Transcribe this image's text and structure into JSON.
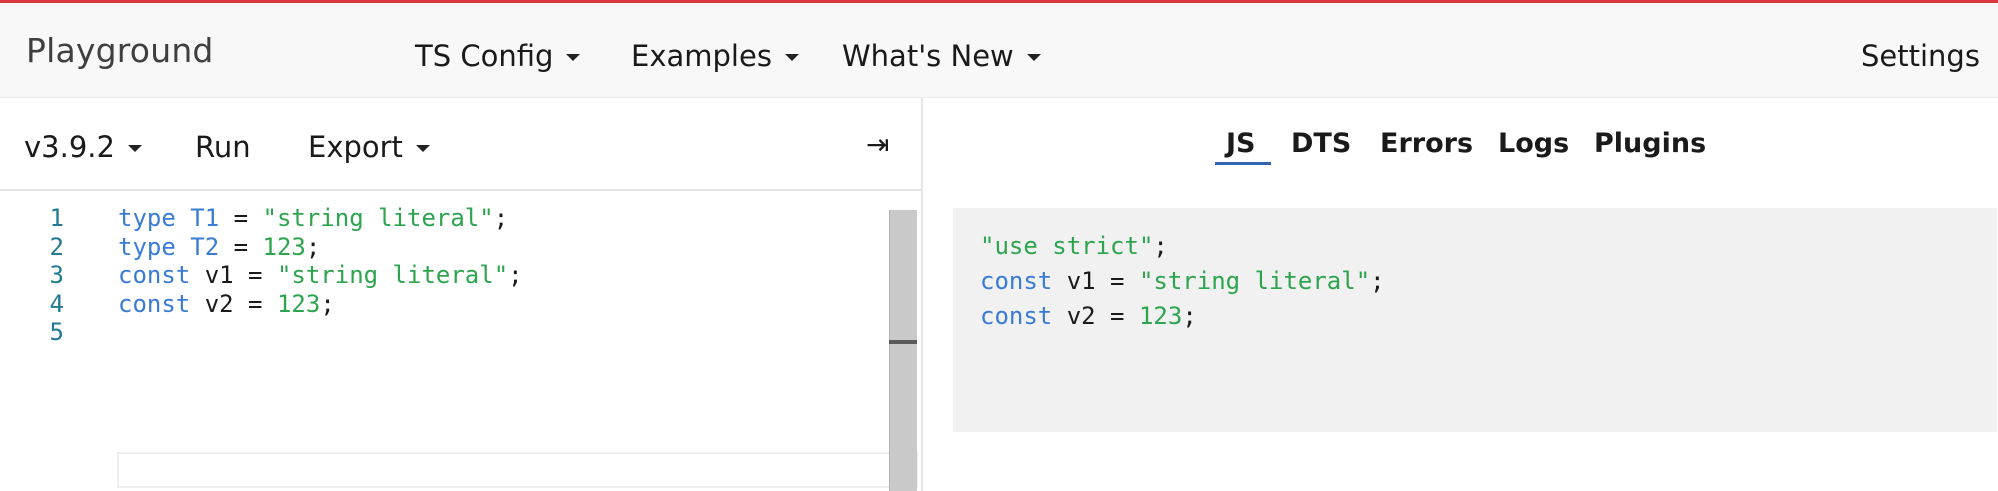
{
  "navbar": {
    "brand": "Playground",
    "menus": [
      {
        "label": "TS Config"
      },
      {
        "label": "Examples"
      },
      {
        "label": "What's New"
      }
    ],
    "settings_label": "Settings"
  },
  "toolbar": {
    "version_label": "v3.9.2",
    "run_label": "Run",
    "export_label": "Export",
    "collapse_glyph": "⇥"
  },
  "editor": {
    "lines": [
      {
        "num": "1",
        "tokens": [
          {
            "t": "type",
            "c": "kw"
          },
          {
            "t": " "
          },
          {
            "t": "T1",
            "c": "kw"
          },
          {
            "t": " = "
          },
          {
            "t": "\"string literal\"",
            "c": "str"
          },
          {
            "t": ";"
          }
        ]
      },
      {
        "num": "2",
        "tokens": [
          {
            "t": "type",
            "c": "kw"
          },
          {
            "t": " "
          },
          {
            "t": "T2",
            "c": "kw"
          },
          {
            "t": " = "
          },
          {
            "t": "123",
            "c": "num"
          },
          {
            "t": ";"
          }
        ]
      },
      {
        "num": "3",
        "tokens": [
          {
            "t": "const",
            "c": "kw"
          },
          {
            "t": " v1 = "
          },
          {
            "t": "\"string literal\"",
            "c": "str"
          },
          {
            "t": ";"
          }
        ]
      },
      {
        "num": "4",
        "tokens": [
          {
            "t": "const",
            "c": "kw"
          },
          {
            "t": " v2 = "
          },
          {
            "t": "123",
            "c": "num"
          },
          {
            "t": ";"
          }
        ]
      },
      {
        "num": "5",
        "tokens": []
      }
    ]
  },
  "output_tabs": [
    {
      "label": "JS",
      "active": true
    },
    {
      "label": "DTS",
      "active": false
    },
    {
      "label": "Errors",
      "active": false
    },
    {
      "label": "Logs",
      "active": false
    },
    {
      "label": "Plugins",
      "active": false
    }
  ],
  "output": {
    "lines": [
      {
        "tokens": [
          {
            "t": "\"use strict\"",
            "c": "str"
          },
          {
            "t": ";"
          }
        ]
      },
      {
        "tokens": [
          {
            "t": "const",
            "c": "kw"
          },
          {
            "t": " v1 = "
          },
          {
            "t": "\"string literal\"",
            "c": "str"
          },
          {
            "t": ";"
          }
        ]
      },
      {
        "tokens": [
          {
            "t": "const",
            "c": "kw"
          },
          {
            "t": " v2 = "
          },
          {
            "t": "123",
            "c": "num"
          },
          {
            "t": ";"
          }
        ]
      }
    ]
  },
  "colors": {
    "accent_stripe": "#d9363e",
    "keyword": "#3a7bd5",
    "string": "#2da44e",
    "line_number": "#237893",
    "active_tab_underline": "#3266b3"
  }
}
